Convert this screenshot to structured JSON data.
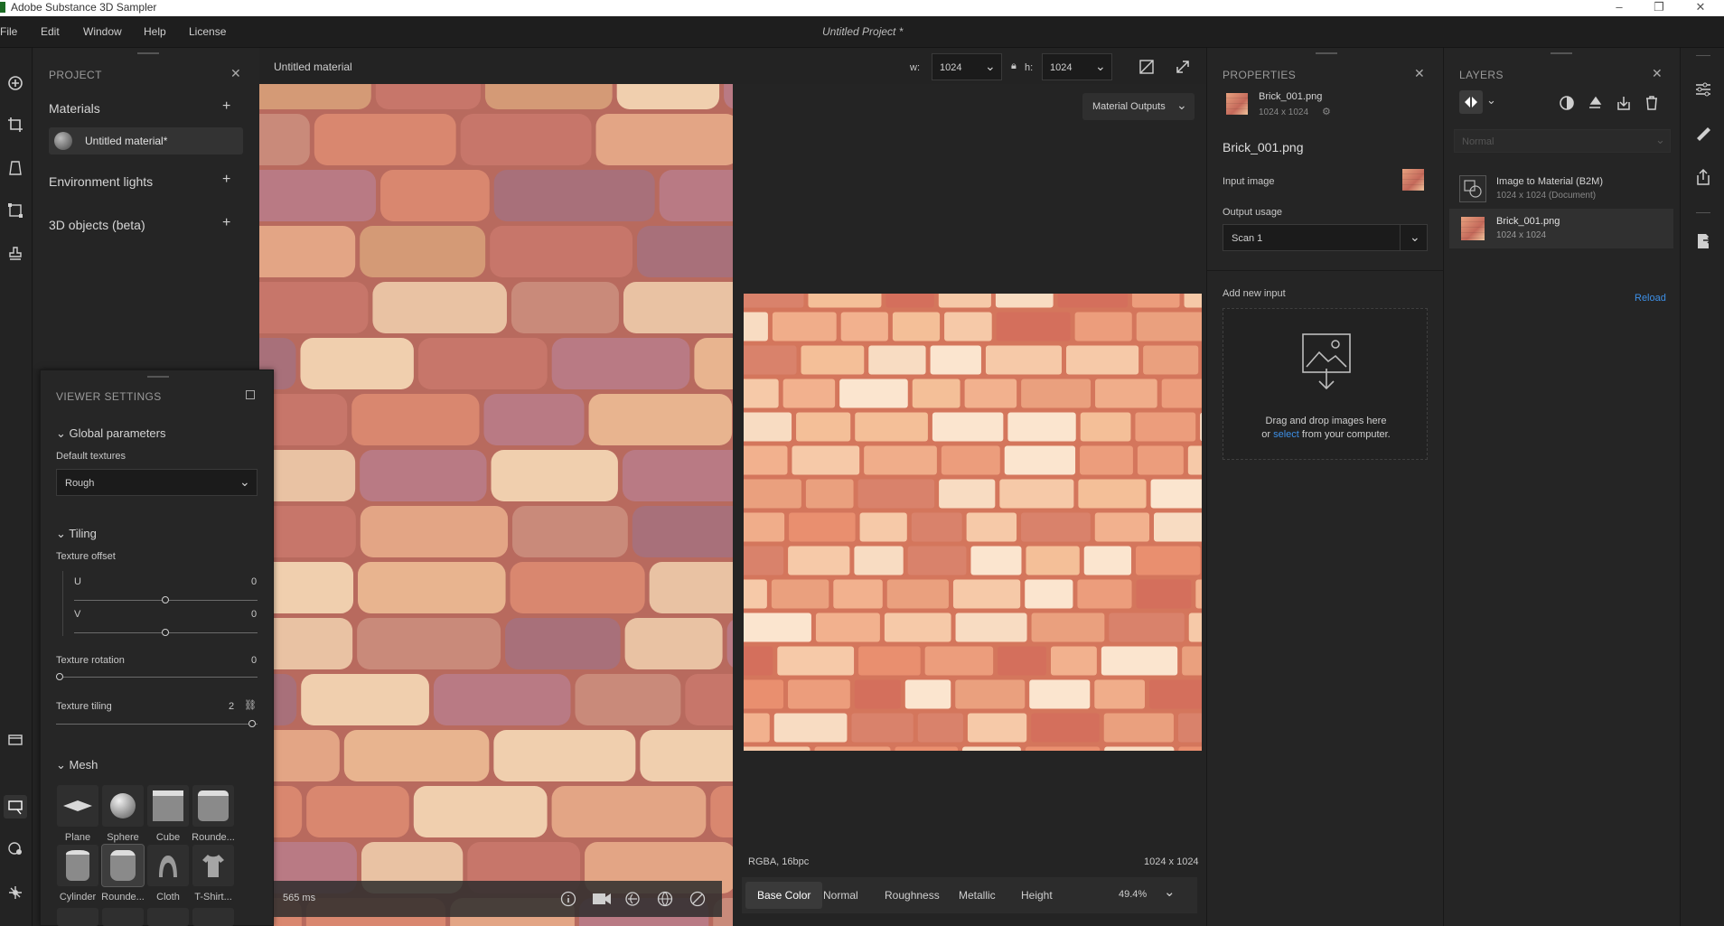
{
  "window": {
    "title": "Adobe Substance 3D Sampler",
    "controls": [
      "–",
      "❐",
      "✕"
    ]
  },
  "menu": {
    "items": [
      "File",
      "Edit",
      "Window",
      "Help",
      "License"
    ],
    "document_title": "Untitled Project *"
  },
  "project_panel": {
    "header": "PROJECT",
    "materials_label": "Materials",
    "material_item": "Untitled material*",
    "env_lights_label": "Environment lights",
    "objects_label": "3D objects (beta)"
  },
  "viewer_settings": {
    "header": "VIEWER SETTINGS",
    "global_params": "Global parameters",
    "default_textures_label": "Default textures",
    "default_textures_value": "Rough",
    "tiling_label": "Tiling",
    "texture_offset_label": "Texture offset",
    "u_label": "U",
    "u_value": "0",
    "v_label": "V",
    "v_value": "0",
    "rotation_label": "Texture rotation",
    "rotation_value": "0",
    "tiling_value_label": "Texture tiling",
    "tiling_value": "2",
    "mesh_label": "Mesh",
    "meshes": [
      "Plane",
      "Sphere",
      "Cube",
      "Rounde...",
      "Cylinder",
      "Rounde...",
      "Cloth",
      "T-Shirt..."
    ]
  },
  "viewport": {
    "title": "Untitled material",
    "w_label": "w:",
    "w_value": "1024",
    "h_label": "h:",
    "h_value": "1024",
    "material_outputs": "Material Outputs",
    "timing": "565 ms",
    "info_left": "RGBA, 16bpc",
    "info_right": "1024 x 1024",
    "zoom": "49.4%",
    "channels": [
      "Base Color",
      "Normal",
      "Roughness",
      "Metallic",
      "Height"
    ],
    "active_channel": "Base Color"
  },
  "properties_panel": {
    "header": "PROPERTIES",
    "file_name": "Brick_001.png",
    "file_dims": "1024 x 1024",
    "title": "Brick_001.png",
    "input_image_label": "Input image",
    "output_usage_label": "Output usage",
    "output_usage_value": "Scan 1",
    "add_new_input": "Add new input",
    "drop_line1": "Drag and drop images here",
    "drop_or": "or ",
    "drop_select": "select",
    "drop_rest": " from your computer."
  },
  "layers_panel": {
    "header": "LAYERS",
    "blend_mode": "Normal",
    "layers": [
      {
        "name": "Image to Material (B2M)",
        "sub": "1024 x 1024 (Document)"
      },
      {
        "name": "Brick_001.png",
        "sub": "1024 x 1024"
      }
    ],
    "reload": "Reload"
  },
  "colors": {
    "accent": "#3d8fe6",
    "panel": "#252525",
    "background": "#232323"
  }
}
